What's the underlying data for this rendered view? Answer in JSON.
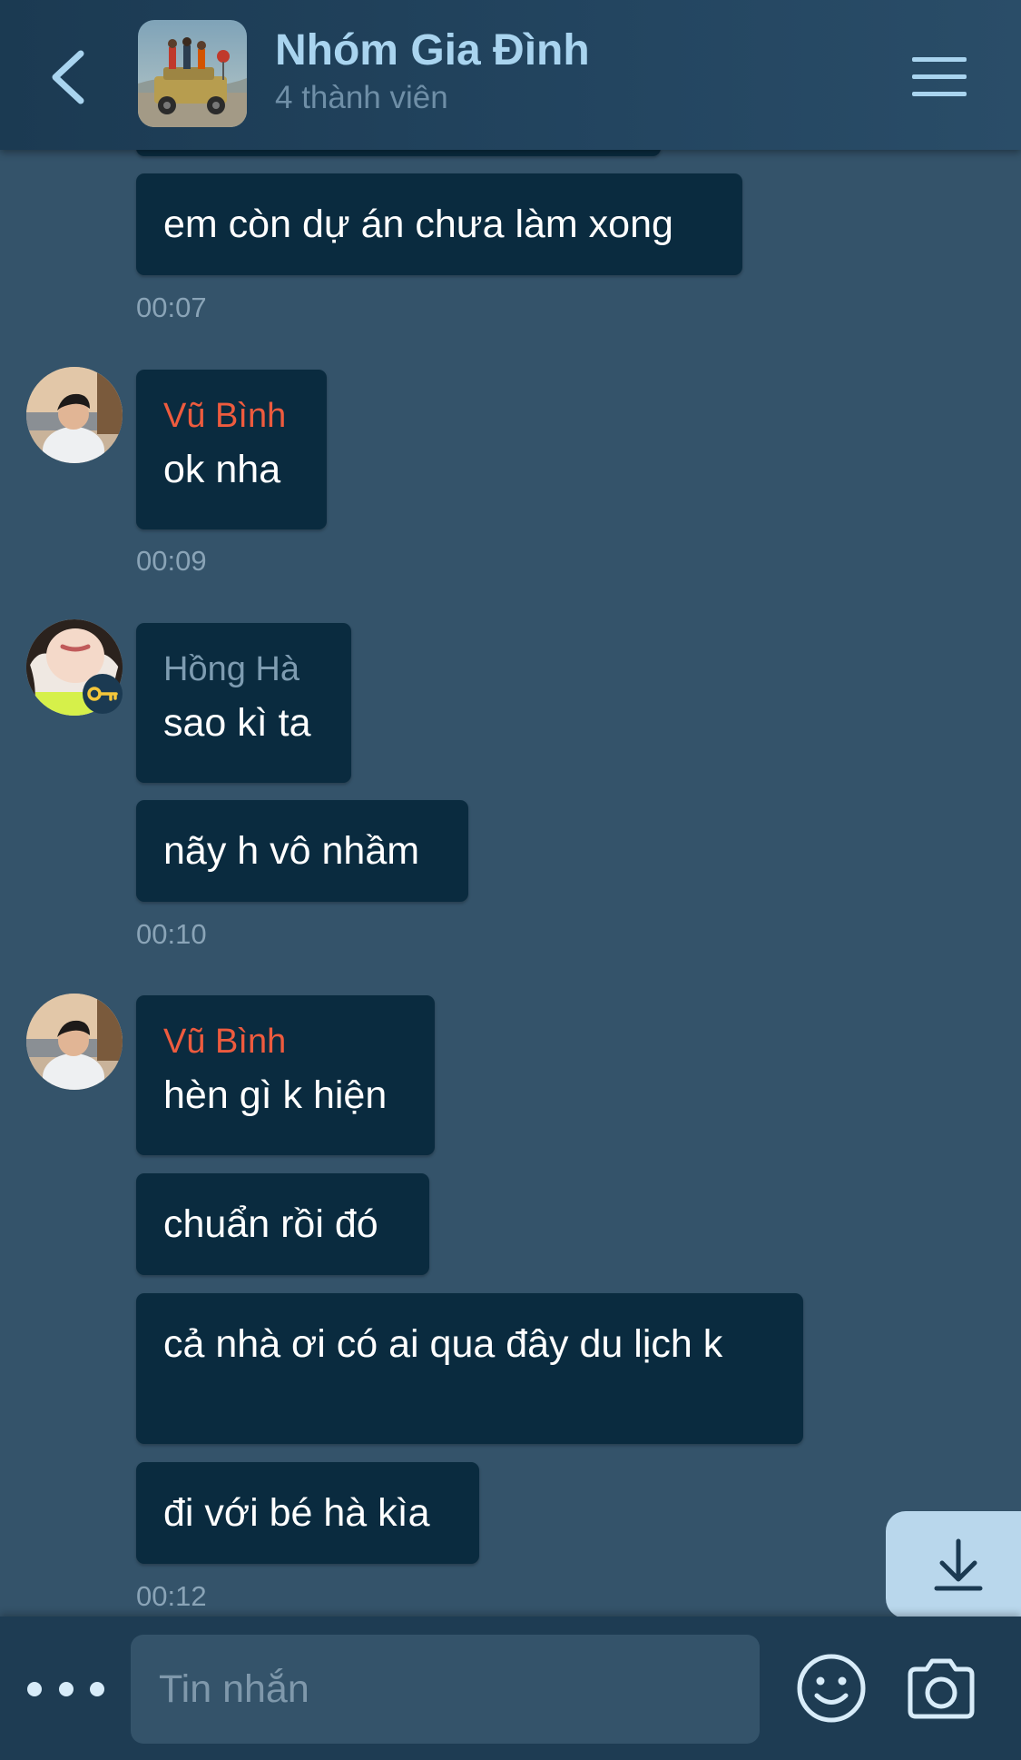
{
  "header": {
    "title": "Nhóm Gia Đình",
    "subtitle": "4 thành viên"
  },
  "messages": {
    "m1": {
      "text": "em còn dự án chưa làm xong",
      "time": "00:07"
    },
    "m2": {
      "sender": "Vũ Bình",
      "text": "ok nha",
      "time": "00:09"
    },
    "m3": {
      "sender": "Hồng Hà",
      "text1": "sao kì ta",
      "text2": "nãy h vô nhầm",
      "time": "00:10"
    },
    "m4": {
      "sender": "Vũ Bình",
      "text1": "hèn gì k hiện",
      "text2": "chuẩn rồi đó",
      "text3": "cả nhà ơi có ai qua đây du lịch k",
      "text4": "đi với bé hà kìa",
      "time": "00:12"
    }
  },
  "composer": {
    "placeholder": "Tin nhắn"
  },
  "colors": {
    "background": "#34536a",
    "header": "#1b3a52",
    "bubble": "#0a2b3f",
    "accent": "#a9d4ef",
    "sender_vu_binh": "#ee5b3e",
    "sender_hong_ha": "#7e9cb1",
    "admin_key": "#f4c63a"
  },
  "icons": {
    "back": "chevron-left-icon",
    "menu": "hamburger-menu-icon",
    "scroll": "arrow-down-icon",
    "more": "more-dots-icon",
    "emoji": "emoji-icon",
    "camera": "camera-icon",
    "admin": "key-icon"
  }
}
